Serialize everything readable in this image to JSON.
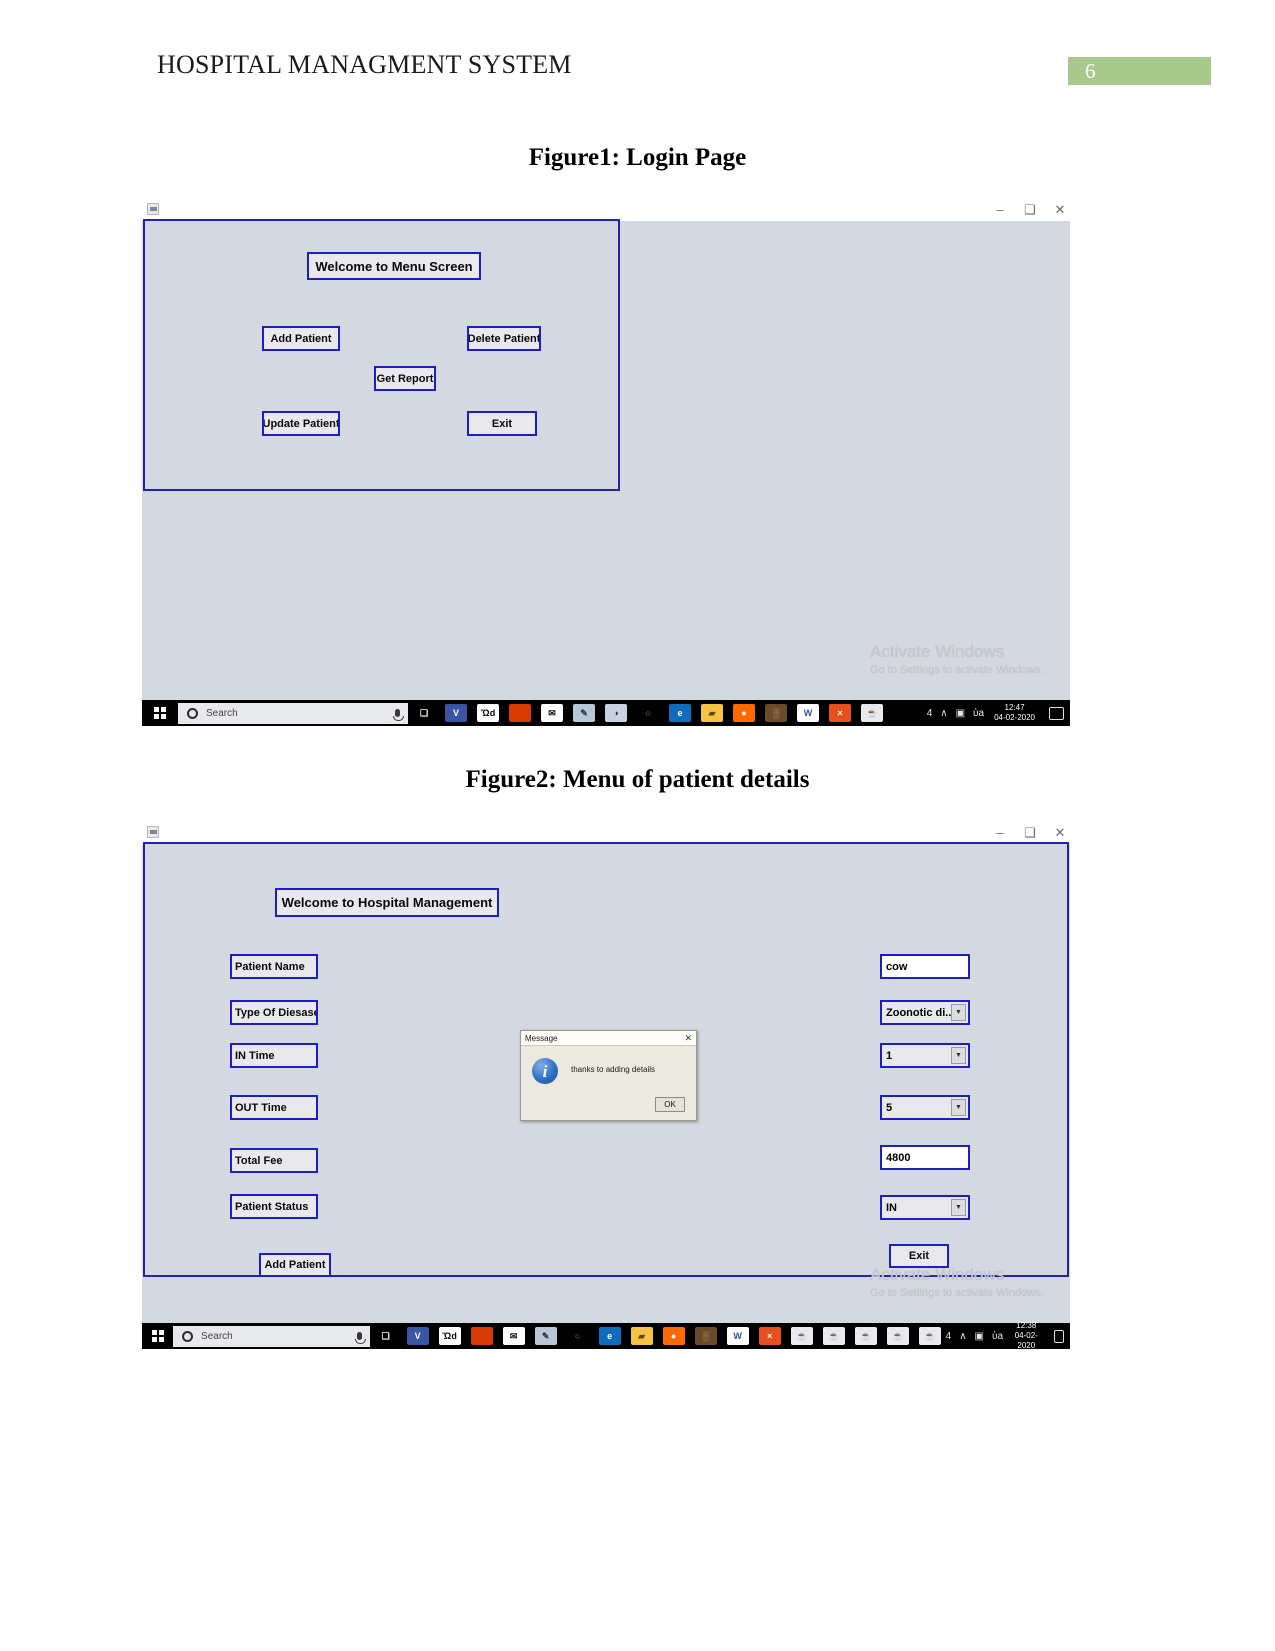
{
  "document": {
    "header_title": "HOSPITAL MANAGMENT SYSTEM",
    "page_number": "6",
    "page_badge_color": "#a9c98c"
  },
  "figure1": {
    "caption": "Figure1: Login Page",
    "window": {
      "controls": {
        "minimize": "–",
        "maximize": "❑",
        "close": "✕"
      },
      "title_box": "Welcome to  Menu Screen",
      "buttons": [
        {
          "label": "Add Patient"
        },
        {
          "label": "Delete Patient"
        },
        {
          "label": "Get Report"
        },
        {
          "label": "Update Patient"
        },
        {
          "label": "Exit"
        }
      ],
      "watermark_line1": "Activate Windows",
      "watermark_line2": "Go to Settings to activate Windows."
    },
    "taskbar": {
      "search_placeholder": "Search",
      "clock_time": "12:47",
      "clock_date": "04-02-2020",
      "apps": [
        {
          "name": "task-view",
          "glyph": "❑",
          "bg": "#000000",
          "fg": "#ffffff"
        },
        {
          "name": "visio",
          "glyph": "V",
          "bg": "#3955a3",
          "fg": "#ffffff"
        },
        {
          "name": "microsoft-store",
          "glyph": "Ὤd",
          "bg": "#ffffff",
          "fg": "#000000"
        },
        {
          "name": "office",
          "glyph": "",
          "bg": "#d83b01",
          "fg": "#ffffff"
        },
        {
          "name": "mail",
          "glyph": "✉",
          "bg": "#ffffff",
          "fg": "#111111"
        },
        {
          "name": "paint",
          "glyph": "✎",
          "bg": "#b9c6d6",
          "fg": "#333333"
        },
        {
          "name": "paint-3d",
          "glyph": "◑",
          "bg": "#c9d3e0",
          "fg": "#333333"
        },
        {
          "name": "loading-ring",
          "glyph": "○",
          "bg": "#000000",
          "fg": "#2ecc40"
        },
        {
          "name": "edge",
          "glyph": "e",
          "bg": "#0f6cbd",
          "fg": "#ffffff"
        },
        {
          "name": "file-explorer",
          "glyph": "▰",
          "bg": "#f6c344",
          "fg": "#5a4a10"
        },
        {
          "name": "firefox",
          "glyph": "●",
          "bg": "#ff6a00",
          "fg": "#ffffff"
        },
        {
          "name": "game",
          "glyph": "░",
          "bg": "#6a4a2a",
          "fg": "#ffd27f"
        },
        {
          "name": "word",
          "glyph": "W",
          "bg": "#ffffff",
          "fg": "#2b579a"
        },
        {
          "name": "xmind",
          "glyph": "×",
          "bg": "#e8501e",
          "fg": "#ffffff"
        },
        {
          "name": "java-app",
          "glyph": "☕",
          "bg": "#e9eaef",
          "fg": "#444444"
        }
      ],
      "tray": [
        {
          "name": "people-icon",
          "glyph": "὆4"
        },
        {
          "name": "show-hidden-icons",
          "glyph": "∧"
        },
        {
          "name": "network-icon",
          "glyph": "▣"
        },
        {
          "name": "volume-icon",
          "glyph": "ὐa"
        }
      ]
    }
  },
  "figure2": {
    "caption": "Figure2: Menu of patient details",
    "window": {
      "controls": {
        "minimize": "–",
        "maximize": "❑",
        "close": "✕"
      },
      "title_box": "Welcome to Hospital Management",
      "fields": [
        {
          "label": "Patient Name",
          "value": "cow",
          "kind": "text"
        },
        {
          "label": "Type Of Diesases",
          "value": "Zoonotic di...",
          "kind": "combo"
        },
        {
          "label": "IN Time",
          "value": "1",
          "kind": "combo"
        },
        {
          "label": "OUT Time",
          "value": "5",
          "kind": "combo"
        },
        {
          "label": "Total Fee",
          "value": "4800",
          "kind": "text"
        },
        {
          "label": "Patient  Status",
          "value": "IN",
          "kind": "combo"
        }
      ],
      "add_button": "Add Patient",
      "exit_button": "Exit",
      "watermark_line1": "Activate Windows",
      "watermark_line2": "Go to Settings to activate Windows."
    },
    "dialog": {
      "title": "Message",
      "close_glyph": "✕",
      "icon": "i",
      "message": "thanks to adding details",
      "ok_label": "OK"
    },
    "taskbar": {
      "search_placeholder": "Search",
      "clock_time": "12:38",
      "clock_date": "04-02-2020",
      "apps": [
        {
          "name": "task-view",
          "glyph": "❑",
          "bg": "#000000",
          "fg": "#ffffff"
        },
        {
          "name": "visio",
          "glyph": "V",
          "bg": "#3955a3",
          "fg": "#ffffff"
        },
        {
          "name": "microsoft-store",
          "glyph": "Ὤd",
          "bg": "#ffffff",
          "fg": "#000000"
        },
        {
          "name": "office",
          "glyph": "",
          "bg": "#d83b01",
          "fg": "#ffffff"
        },
        {
          "name": "mail",
          "glyph": "✉",
          "bg": "#ffffff",
          "fg": "#111111"
        },
        {
          "name": "paint",
          "glyph": "✎",
          "bg": "#b9c6d6",
          "fg": "#333333"
        },
        {
          "name": "loading-ring",
          "glyph": "○",
          "bg": "#000000",
          "fg": "#2ecc40"
        },
        {
          "name": "edge",
          "glyph": "e",
          "bg": "#0f6cbd",
          "fg": "#ffffff"
        },
        {
          "name": "file-explorer",
          "glyph": "▰",
          "bg": "#f6c344",
          "fg": "#5a4a10"
        },
        {
          "name": "firefox",
          "glyph": "●",
          "bg": "#ff6a00",
          "fg": "#ffffff"
        },
        {
          "name": "game",
          "glyph": "░",
          "bg": "#6a4a2a",
          "fg": "#ffd27f"
        },
        {
          "name": "word",
          "glyph": "W",
          "bg": "#ffffff",
          "fg": "#2b579a"
        },
        {
          "name": "xmind",
          "glyph": "×",
          "bg": "#e8501e",
          "fg": "#ffffff"
        },
        {
          "name": "java-app-1",
          "glyph": "☕",
          "bg": "#e9eaef",
          "fg": "#444444"
        },
        {
          "name": "java-app-2",
          "glyph": "☕",
          "bg": "#e9eaef",
          "fg": "#444444"
        },
        {
          "name": "java-app-3",
          "glyph": "☕",
          "bg": "#e9eaef",
          "fg": "#444444"
        },
        {
          "name": "java-app-4",
          "glyph": "☕",
          "bg": "#e9eaef",
          "fg": "#444444"
        },
        {
          "name": "java-app-5",
          "glyph": "☕",
          "bg": "#e9eaef",
          "fg": "#444444"
        }
      ],
      "tray": [
        {
          "name": "people-icon",
          "glyph": "὆4"
        },
        {
          "name": "show-hidden-icons",
          "glyph": "∧"
        },
        {
          "name": "network-icon",
          "glyph": "▣"
        },
        {
          "name": "volume-icon",
          "glyph": "ὐa"
        }
      ]
    }
  }
}
